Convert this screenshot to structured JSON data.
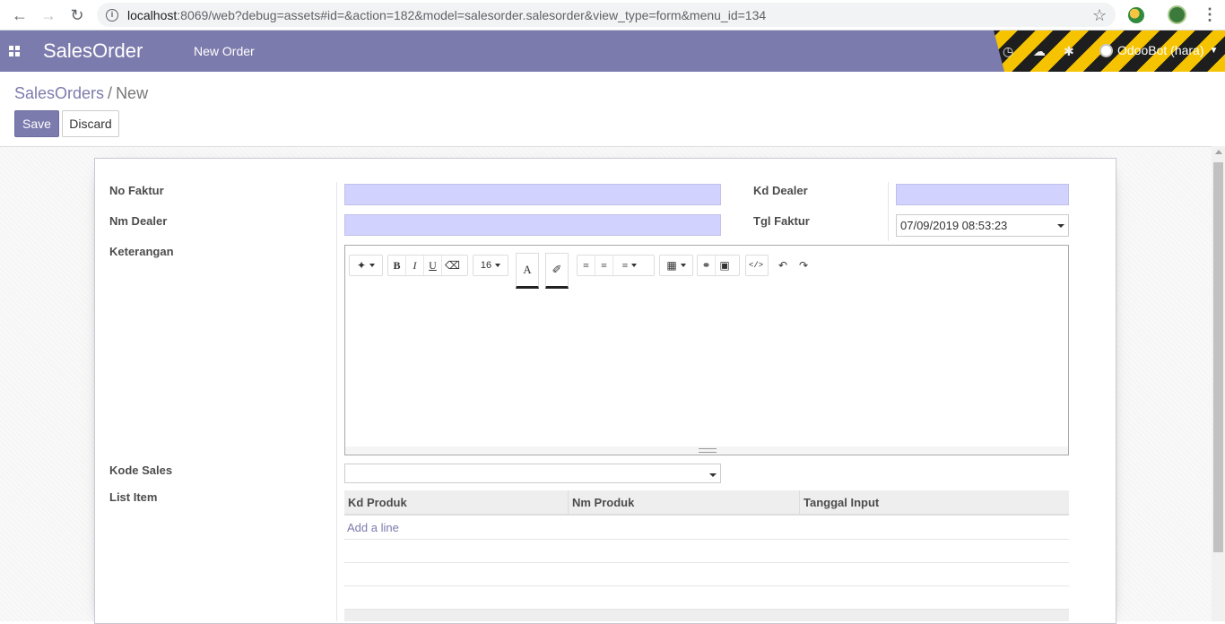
{
  "browser": {
    "url_host": "localhost",
    "url_rest": ":8069/web?debug=assets#id=&action=182&model=salesorder.salesorder&view_type=form&menu_id=134"
  },
  "navbar": {
    "brand": "SalesOrder",
    "menu_item": "New Order",
    "user": "OdooBot (hara)",
    "accent_color": "#7c7bad"
  },
  "control_panel": {
    "breadcrumb_parent": "SalesOrders",
    "breadcrumb_sep": "/",
    "breadcrumb_current": "New",
    "save_label": "Save",
    "discard_label": "Discard"
  },
  "form": {
    "no_faktur_label": "No Faktur",
    "nm_dealer_label": "Nm Dealer",
    "keterangan_label": "Keterangan",
    "kd_dealer_label": "Kd Dealer",
    "tgl_faktur_label": "Tgl Faktur",
    "tgl_faktur_value": "07/09/2019 08:53:23",
    "kode_sales_label": "Kode Sales",
    "list_item_label": "List Item",
    "required_field_color": "#d2d2ff"
  },
  "editor": {
    "font_size": "16",
    "bold": "B",
    "italic": "I",
    "underline": "U",
    "fore_color": "A"
  },
  "list": {
    "columns": [
      "Kd Produk",
      "Nm Produk",
      "Tanggal Input"
    ],
    "add_line": "Add a line"
  }
}
